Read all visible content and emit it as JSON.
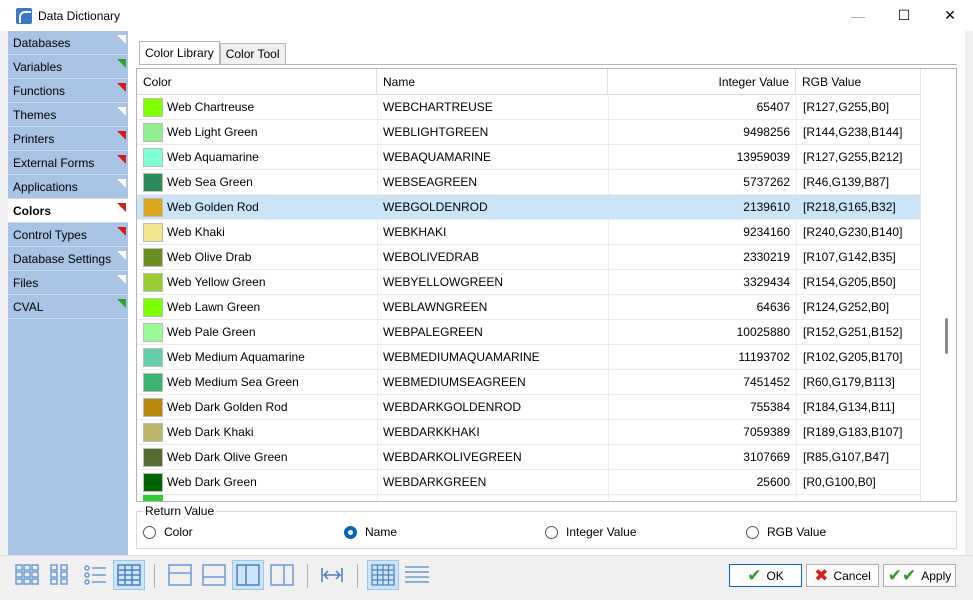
{
  "window": {
    "title": "Data Dictionary",
    "minimize": "—",
    "maximize": "☐",
    "close": "✕"
  },
  "sidebar": {
    "items": [
      {
        "label": "Databases",
        "marker": "#ffffff"
      },
      {
        "label": "Variables",
        "marker": "#2aa52a"
      },
      {
        "label": "Functions",
        "marker": "#d02020"
      },
      {
        "label": "Themes",
        "marker": "#ffffff"
      },
      {
        "label": "Printers",
        "marker": "#d02020"
      },
      {
        "label": "External Forms",
        "marker": "#d02020"
      },
      {
        "label": "Applications",
        "marker": "#ffffff"
      },
      {
        "label": "Colors",
        "marker": "#d02020",
        "selected": true
      },
      {
        "label": "Control Types",
        "marker": "#d02020"
      },
      {
        "label": "Database Settings",
        "marker": "#ffffff"
      },
      {
        "label": "Files",
        "marker": "#ffffff"
      },
      {
        "label": "CVAL",
        "marker": "#2aa52a"
      }
    ]
  },
  "tabs": [
    {
      "label": "Color Library",
      "active": true
    },
    {
      "label": "Color Tool"
    }
  ],
  "grid": {
    "columns": {
      "color": "Color",
      "name": "Name",
      "integer": "Integer Value",
      "rgb": "RGB Value"
    },
    "rows": [
      {
        "swatch": "#7fff00",
        "color": "Web Chartreuse",
        "name": "WEBCHARTREUSE",
        "integer": "65407",
        "rgb": "[R127,G255,B0]"
      },
      {
        "swatch": "#90ee90",
        "color": "Web Light Green",
        "name": "WEBLIGHTGREEN",
        "integer": "9498256",
        "rgb": "[R144,G238,B144]"
      },
      {
        "swatch": "#7fffd4",
        "color": "Web Aquamarine",
        "name": "WEBAQUAMARINE",
        "integer": "13959039",
        "rgb": "[R127,G255,B212]"
      },
      {
        "swatch": "#2e8b57",
        "color": "Web Sea Green",
        "name": "WEBSEAGREEN",
        "integer": "5737262",
        "rgb": "[R46,G139,B87]"
      },
      {
        "swatch": "#daa520",
        "color": "Web Golden Rod",
        "name": "WEBGOLDENROD",
        "integer": "2139610",
        "rgb": "[R218,G165,B32]",
        "selected": true
      },
      {
        "swatch": "#f0e68c",
        "color": "Web Khaki",
        "name": "WEBKHAKI",
        "integer": "9234160",
        "rgb": "[R240,G230,B140]"
      },
      {
        "swatch": "#6b8e23",
        "color": "Web Olive Drab",
        "name": "WEBOLIVEDRAB",
        "integer": "2330219",
        "rgb": "[R107,G142,B35]"
      },
      {
        "swatch": "#9acd32",
        "color": "Web Yellow Green",
        "name": "WEBYELLOWGREEN",
        "integer": "3329434",
        "rgb": "[R154,G205,B50]"
      },
      {
        "swatch": "#7cfc00",
        "color": "Web Lawn Green",
        "name": "WEBLAWNGREEN",
        "integer": "64636",
        "rgb": "[R124,G252,B0]"
      },
      {
        "swatch": "#98fb98",
        "color": "Web Pale Green",
        "name": "WEBPALEGREEN",
        "integer": "10025880",
        "rgb": "[R152,G251,B152]"
      },
      {
        "swatch": "#66cdaa",
        "color": "Web Medium Aquamarine",
        "name": "WEBMEDIUMAQUAMARINE",
        "integer": "11193702",
        "rgb": "[R102,G205,B170]"
      },
      {
        "swatch": "#3cb371",
        "color": "Web Medium Sea Green",
        "name": "WEBMEDIUMSEAGREEN",
        "integer": "7451452",
        "rgb": "[R60,G179,B113]"
      },
      {
        "swatch": "#b8860b",
        "color": "Web Dark Golden Rod",
        "name": "WEBDARKGOLDENROD",
        "integer": "755384",
        "rgb": "[R184,G134,B11]"
      },
      {
        "swatch": "#bdb76b",
        "color": "Web Dark Khaki",
        "name": "WEBDARKKHAKI",
        "integer": "7059389",
        "rgb": "[R189,G183,B107]"
      },
      {
        "swatch": "#556b2f",
        "color": "Web Dark Olive Green",
        "name": "WEBDARKOLIVEGREEN",
        "integer": "3107669",
        "rgb": "[R85,G107,B47]"
      },
      {
        "swatch": "#006400",
        "color": "Web Dark Green",
        "name": "WEBDARKGREEN",
        "integer": "25600",
        "rgb": "[R0,G100,B0]"
      }
    ]
  },
  "return_value": {
    "legend": "Return Value",
    "options": [
      {
        "label": "Color",
        "checked": false
      },
      {
        "label": "Name",
        "checked": true
      },
      {
        "label": "Integer Value",
        "checked": false
      },
      {
        "label": "RGB Value",
        "checked": false
      }
    ]
  },
  "buttons": {
    "ok": "OK",
    "cancel": "Cancel",
    "apply": "Apply"
  },
  "colors": {
    "sidebar_bg": "#a8c3e3",
    "selected_row": "#cce4f7",
    "accent": "#0067c0"
  }
}
